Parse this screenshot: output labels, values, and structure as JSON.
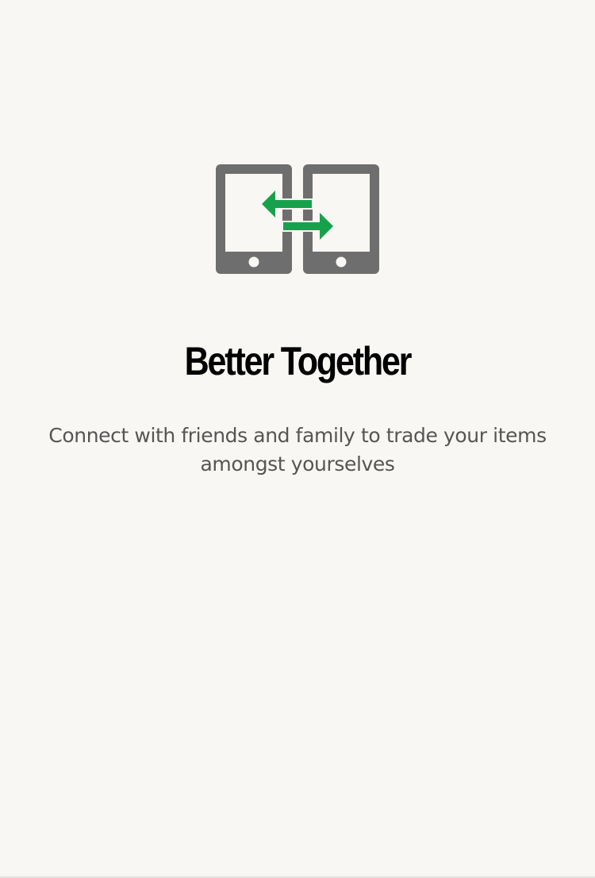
{
  "onboarding": {
    "icon": "phones-exchange-icon",
    "title": "Better Together",
    "subtitle": "Connect with friends and family to trade your items amongst yourselves"
  },
  "colors": {
    "background": "#f8f7f3",
    "device_gray": "#6e6e6e",
    "arrow_green": "#16a24c",
    "title": "#000000",
    "subtitle": "#555555"
  }
}
